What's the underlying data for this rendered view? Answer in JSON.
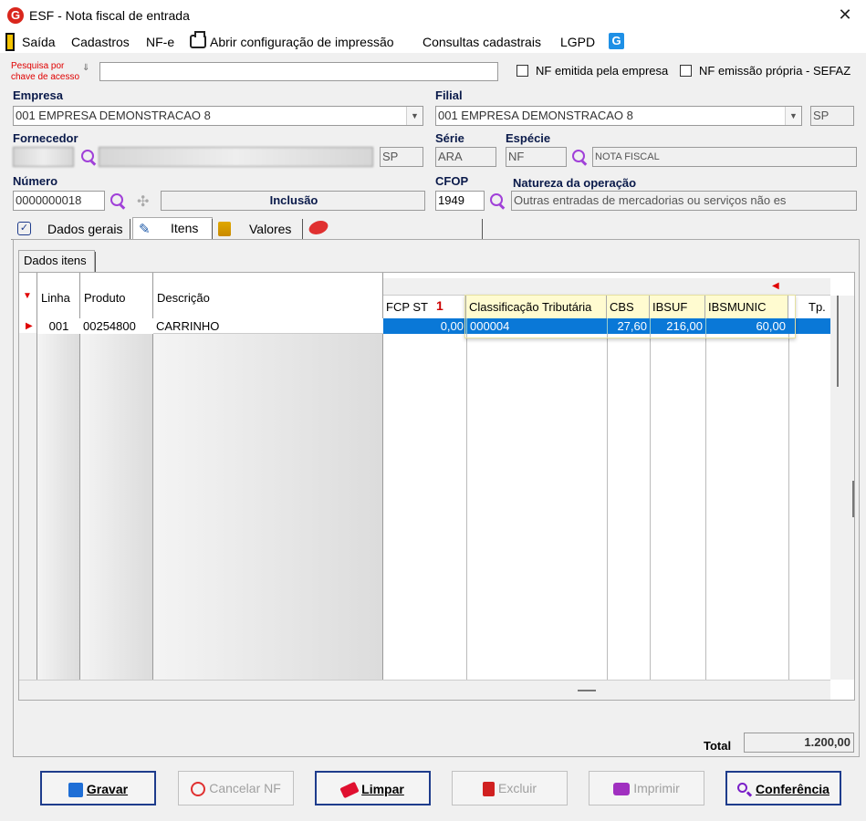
{
  "window": {
    "title": "ESF - Nota fiscal de entrada",
    "close": "✕",
    "logo": "G"
  },
  "menu": {
    "items": [
      "Saída",
      "Cadastros",
      "NF-e",
      "Abrir configuração de impressão",
      "Consultas cadastrais",
      "LGPD"
    ]
  },
  "search": {
    "label_line1": "Pesquisa por",
    "label_line2": "chave de acesso",
    "value": ""
  },
  "checks": {
    "nf_empresa": "NF emitida pela empresa",
    "nf_propria": "NF emissão própria - SEFAZ"
  },
  "empresa": {
    "label": "Empresa",
    "value": "001 EMPRESA DEMONSTRACAO 8"
  },
  "filial": {
    "label": "Filial",
    "value": "001 EMPRESA DEMONSTRACAO 8",
    "uf": "SP"
  },
  "fornecedor": {
    "label": "Fornecedor",
    "uf": "SP"
  },
  "serie": {
    "label": "Série",
    "value": "ARA"
  },
  "especie": {
    "label": "Espécie",
    "code": "NF",
    "desc": "NOTA FISCAL"
  },
  "numero": {
    "label": "Número",
    "value": "0000000018",
    "status": "Inclusão"
  },
  "cfop": {
    "label": "CFOP",
    "value": "1949"
  },
  "natureza": {
    "label": "Natureza da operação",
    "value": "Outras entradas  de mercadorias ou serviços não es"
  },
  "tabs": [
    "Dados gerais",
    "Itens",
    "Valores"
  ],
  "subtab": "Dados itens",
  "grid": {
    "columns": [
      "Linha",
      "Produto",
      "Descrição",
      "FCP ST",
      "Classificação Tributária",
      "CBS",
      "IBSUF",
      "IBSMUNIC",
      "Tp."
    ],
    "sort_badge": "1",
    "rows": [
      {
        "linha": "001",
        "produto": "00254800",
        "descricao": "CARRINHO",
        "fcp_st": "0,00",
        "class_trib": "000004",
        "cbs": "27,60",
        "ibsuf": "216,00",
        "ibsmunic": "60,00"
      }
    ]
  },
  "total": {
    "label": "Total",
    "value": "1.200,00"
  },
  "buttons": {
    "gravar": "Gravar",
    "cancelar": "Cancelar NF",
    "limpar": "Limpar",
    "excluir": "Excluir",
    "imprimir": "Imprimir",
    "conferencia": "Conferência"
  },
  "colors": {
    "accent": "#0078d7",
    "selection": "#0a78d7",
    "highlight": "#fffbd0",
    "red": "#e00000"
  }
}
